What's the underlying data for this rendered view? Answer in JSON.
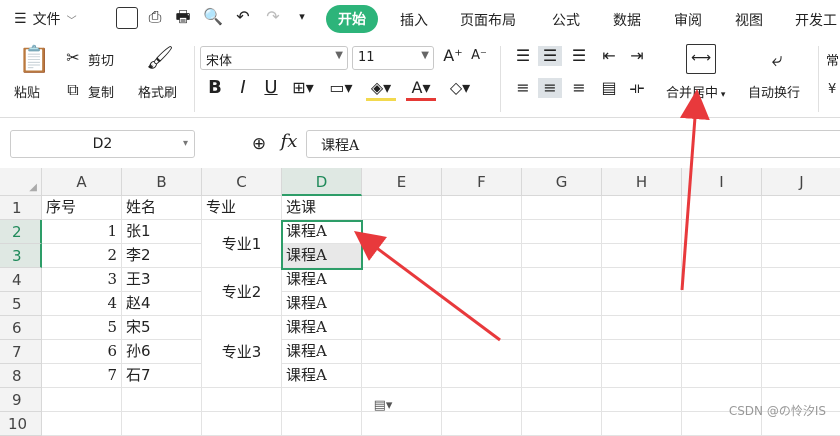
{
  "tabbar": {
    "file": "文件",
    "tabs": [
      "开始",
      "插入",
      "页面布局",
      "公式",
      "数据",
      "审阅",
      "视图",
      "开发工"
    ]
  },
  "ribbon": {
    "clipboard": {
      "paste": "粘贴",
      "cut": "剪切",
      "copy": "复制",
      "format_painter": "格式刷"
    },
    "font": {
      "name": "宋体",
      "size": "11"
    },
    "merge": "合并居中",
    "wrap": "自动换行",
    "numfmt": "常"
  },
  "formula_bar": {
    "cell_ref": "D2",
    "fx": "fx",
    "content": "课程A"
  },
  "columns": [
    "A",
    "B",
    "C",
    "D",
    "E",
    "F",
    "G",
    "H",
    "I",
    "J"
  ],
  "rows": [
    "1",
    "2",
    "3",
    "4",
    "5",
    "6",
    "7",
    "8",
    "9",
    "10"
  ],
  "table": {
    "headers": [
      "序号",
      "姓名",
      "专业",
      "选课"
    ],
    "seq": [
      "1",
      "2",
      "3",
      "4",
      "5",
      "6",
      "7"
    ],
    "names": [
      "张1",
      "李2",
      "王3",
      "赵4",
      "宋5",
      "孙6",
      "石7"
    ],
    "majors": [
      "专业1",
      "专业2",
      "专业3"
    ],
    "courses": [
      "课程A",
      "课程A",
      "课程A",
      "课程A",
      "课程A",
      "课程A",
      "课程A"
    ]
  },
  "watermark": "CSDN @の怜汐IS",
  "colors": {
    "accent": "#2db47a",
    "selection": "#2d9d68",
    "arrow": "#e8393c"
  }
}
